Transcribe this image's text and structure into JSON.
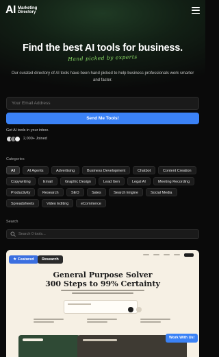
{
  "header": {
    "logo_mark": "AI",
    "logo_line1": "Marketing",
    "logo_line2": "Directory"
  },
  "hero": {
    "title": "Find the best AI tools for business.",
    "handwritten": "Hand picked by experts",
    "description": "Our curated directory of AI tools have been hand picked to help business professionals work smarter and faster."
  },
  "signup": {
    "email_placeholder": "Your Email Address",
    "button_label": "Send Me Tools!",
    "inbox_text": "Get AI tools in your inbox.",
    "joined_text": "2,000+ Joined",
    "avatar_colors": [
      "#d9d9d9",
      "#8a8a8a",
      "#f0f0f0"
    ]
  },
  "categories": {
    "label": "Categories",
    "items": [
      "All",
      "AI Agents",
      "Advertising",
      "Business Development",
      "Chatbot",
      "Content Creation",
      "Copywriting",
      "Email",
      "Graphic Design",
      "Lead Gen",
      "Legal AI",
      "Meeting Recording",
      "Productivity",
      "Research",
      "SEO",
      "Sales",
      "Search Engine",
      "Social Media",
      "Spreadsheets",
      "Video Editing",
      "eCommerce"
    ],
    "active": "All"
  },
  "search": {
    "label": "Search",
    "placeholder": "Search 0 tools..."
  },
  "card": {
    "badge_featured": "Featured",
    "badge_research": "Research",
    "preview_title_1": "General Purpose Solver",
    "preview_title_2": "300 Steps to 99% Certainty"
  },
  "floating_button": {
    "label": "Work With Us!"
  },
  "colors": {
    "accent_blue": "#3b82f6",
    "hand_green": "#8fe36a",
    "background": "#0a0a0a"
  }
}
